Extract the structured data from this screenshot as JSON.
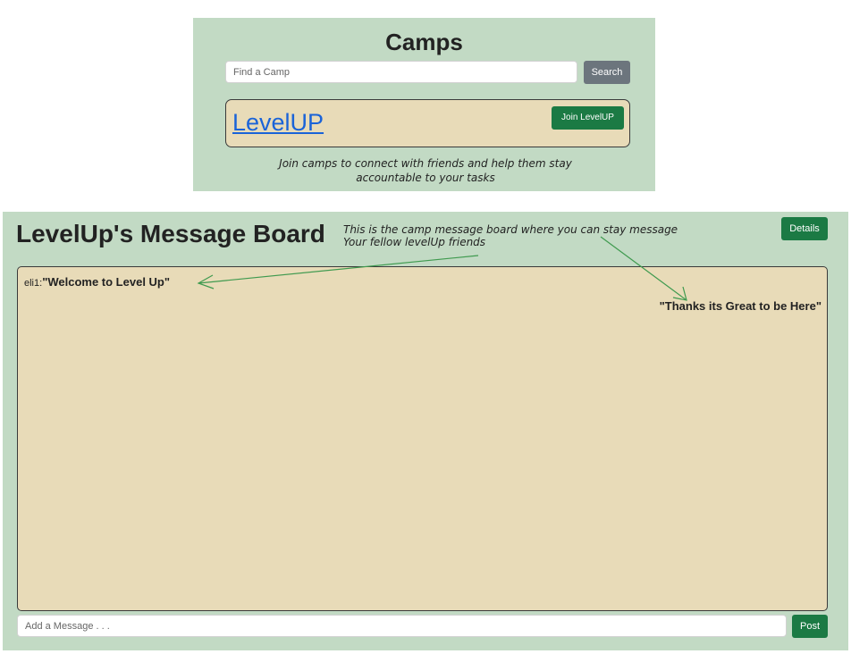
{
  "camps": {
    "title": "Camps",
    "search_placeholder": "Find a Camp",
    "search_label": "Search",
    "card": {
      "camp_name": "LevelUP",
      "join_label": "Join LevelUP"
    },
    "note": "Join camps to connect with friends and help them stay accountable to your tasks"
  },
  "board": {
    "title": "LevelUp's Message Board",
    "note_line1": "This is the camp message board where you can stay message",
    "note_line2": "Your fellow levelUp friends",
    "details_label": "Details",
    "messages": [
      {
        "author": "eli1:",
        "text": "\"Welcome to Level Up\""
      },
      {
        "text": "\"Thanks its Great to be Here\""
      }
    ],
    "input_placeholder": "Add a Message . . .",
    "post_label": "Post"
  },
  "colors": {
    "panel_bg": "#c2dac4",
    "card_bg": "#e8dbb8",
    "green_button": "#1b7a44",
    "gray_button": "#6c757d",
    "link": "#1a63d8",
    "annotation_arrow": "#3f9a4f"
  }
}
